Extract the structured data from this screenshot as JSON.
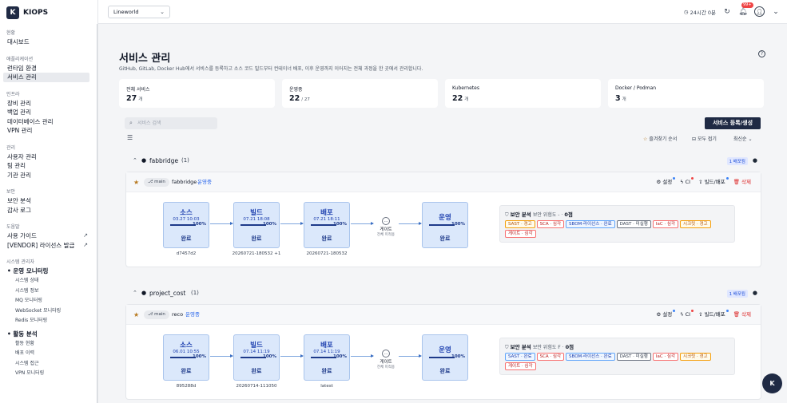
{
  "app": {
    "logo_letter": "K",
    "name": "KIOPS"
  },
  "sidebar": {
    "sections": [
      {
        "title": "현황",
        "items": [
          "대시보드"
        ]
      },
      {
        "title": "애플리케이션",
        "items": [
          "런타임 환경",
          "서비스 관리"
        ]
      },
      {
        "title": "인프라",
        "items": [
          "장비 관리",
          "백업 관리",
          "데이터베이스 관리",
          "VPN 관리"
        ]
      },
      {
        "title": "관리",
        "items": [
          "사용자 관리",
          "팀 관리",
          "기관 관리"
        ]
      },
      {
        "title": "보안",
        "items": [
          "보안 분석",
          "감사 로그"
        ]
      },
      {
        "title": "도움말",
        "items": [
          "사용 가이드",
          "[VENDOR] 라이선스 발급"
        ]
      },
      {
        "title": "시스템 관리자"
      }
    ],
    "groups": [
      {
        "label": "• 운영 모니터링",
        "items": [
          "시스템 상태",
          "시스템 정보",
          "MQ 모니터링",
          "WebSocket 모니터링",
          "Redis 모니터링"
        ]
      },
      {
        "label": "• 활동 분석",
        "items": [
          "활동 현황",
          "배포 이력",
          "시스템 접근",
          "VPN 모니터링"
        ]
      }
    ]
  },
  "topbar": {
    "project": "Lineworld",
    "clock": "24시간 0분",
    "notif_badge": "99+"
  },
  "page": {
    "title": "서비스 관리",
    "description": "GitHub, GitLab, Docker Hub에서 서비스를 등록하고 소스 코드 빌드부터 컨테이너 배포, 이후 운영까지 이어지는 전체 과정을 한 곳에서 관리합니다."
  },
  "stats": [
    {
      "label": "전체 서비스",
      "value": "27",
      "suffix": "개"
    },
    {
      "label": "운영중",
      "value": "22",
      "suffix": "/ 27"
    },
    {
      "label": "Kubernetes",
      "value": "22",
      "suffix": "개"
    },
    {
      "label": "Docker / Podman",
      "value": "3",
      "suffix": "개"
    }
  ],
  "controls": {
    "search_placeholder": "서비스 검색",
    "register": "서비스 등록/생성",
    "favorites": "즐겨찾기 순서",
    "collapse_all": "모두 접기",
    "sort": "최신순"
  },
  "groups": [
    {
      "name": "fabbridge",
      "count": "(1)",
      "deploys": "1 배포됨",
      "branch": "main",
      "service": "fabbridge",
      "status": "운영중",
      "actions": {
        "settings": "설정",
        "ci": "CI",
        "build": "빌드/배포",
        "delete": "삭제"
      },
      "stages": [
        {
          "title": "소스",
          "date": "03.27 10:03",
          "pct": "100%",
          "state": "완료",
          "sub": "d7457d2"
        },
        {
          "title": "빌드",
          "date": "07.21 18:08",
          "pct": "100%",
          "state": "완료",
          "sub": "20260721-180532 +1"
        },
        {
          "title": "배포",
          "date": "07.21 18:11",
          "pct": "100%",
          "state": "완료",
          "sub": "20260721-180532"
        }
      ],
      "gate": {
        "label": "게이트",
        "sub": "전체 미적용"
      },
      "run": {
        "title": "운영",
        "pct": "100%",
        "state": "완료"
      },
      "security": {
        "title": "보안 분석",
        "risk": "보안 위험도 - ·",
        "score": "0점",
        "tags": [
          {
            "t": "SAST · 경고",
            "c": "orange"
          },
          {
            "t": "SCA · 심각",
            "c": "red"
          },
          {
            "t": "SBOM·라이선스 · 완료",
            "c": "blue"
          },
          {
            "t": "DAST · 미실행",
            "c": "gray"
          },
          {
            "t": "IaC · 심각",
            "c": "red"
          },
          {
            "t": "시크릿 · 경고",
            "c": "orange"
          },
          {
            "t": "게이트 · 심각",
            "c": "red"
          }
        ]
      }
    },
    {
      "name": "project_cost",
      "count": "(1)",
      "deploys": "1 배포됨",
      "branch": "main",
      "service": "reco",
      "status": "운영중",
      "actions": {
        "settings": "설정",
        "ci": "CI",
        "build": "빌드/배포",
        "delete": "삭제"
      },
      "stages": [
        {
          "title": "소스",
          "date": "06.01 10:55",
          "pct": "100%",
          "state": "완료",
          "sub": "895288d"
        },
        {
          "title": "빌드",
          "date": "07.14 11:19",
          "pct": "100%",
          "state": "완료",
          "sub": "20260714-111050"
        },
        {
          "title": "배포",
          "date": "07.14 11:19",
          "pct": "100%",
          "state": "완료",
          "sub": "latest"
        }
      ],
      "gate": {
        "label": "게이트",
        "sub": "전체 미적용"
      },
      "run": {
        "title": "운영",
        "pct": "100%",
        "state": "완료"
      },
      "security": {
        "title": "보안 분석",
        "risk": "보안 위험도 F ·",
        "score": "0점",
        "tags": [
          {
            "t": "SAST · 완료",
            "c": "blue"
          },
          {
            "t": "SCA · 심각",
            "c": "red"
          },
          {
            "t": "SBOM·라이선스 · 완료",
            "c": "blue"
          },
          {
            "t": "DAST · 미실행",
            "c": "gray"
          },
          {
            "t": "IaC · 심각",
            "c": "red"
          },
          {
            "t": "시크릿 · 경고",
            "c": "orange"
          },
          {
            "t": "게이트 · 심각",
            "c": "red"
          }
        ]
      }
    }
  ],
  "fab": "K",
  "colors": {
    "brand": "#1f2a44",
    "accent": "#2563eb",
    "stage_bg": "#dbe8fb",
    "danger": "#dc2626"
  }
}
